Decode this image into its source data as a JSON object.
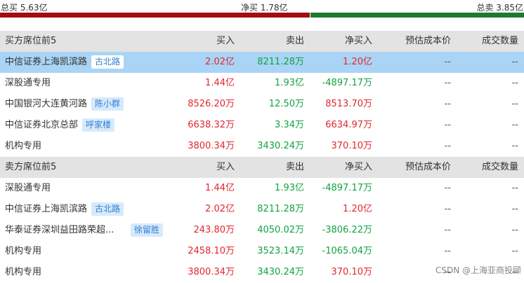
{
  "summary": {
    "total_buy": "总买 5.63亿",
    "net_buy": "净买 1.78亿",
    "total_sell": "总卖 3.85亿"
  },
  "colors": {
    "red": "#e3262e",
    "green": "#12a33f",
    "bar_red": "#a30c10",
    "bar_green": "#1d7a2e",
    "highlight": "#a9d4f5",
    "header_bg": "#e3e3e3",
    "tag_text": "#2f7fd1"
  },
  "buyers": {
    "header": {
      "name": "买方席位前5",
      "buy": "买入",
      "sell": "卖出",
      "net": "净买入",
      "cost": "预估成本价",
      "volume": "成交数量"
    },
    "rows": [
      {
        "name": "中信证券上海凯滨路",
        "tag": "古北路",
        "buy": "2.02亿",
        "sell": "8211.28万",
        "net": "1.20亿",
        "cost": "--",
        "volume": "--"
      },
      {
        "name": "深股通专用",
        "tag": "",
        "buy": "1.44亿",
        "sell": "1.93亿",
        "net": "-4897.17万",
        "cost": "--",
        "volume": "--"
      },
      {
        "name": "中国银河大连黄河路",
        "tag": "陈小群",
        "buy": "8526.20万",
        "sell": "12.50万",
        "net": "8513.70万",
        "cost": "--",
        "volume": "--"
      },
      {
        "name": "中信证券北京总部",
        "tag": "呼家楼",
        "buy": "6638.32万",
        "sell": "3.34万",
        "net": "6634.97万",
        "cost": "--",
        "volume": "--"
      },
      {
        "name": "机构专用",
        "tag": "",
        "buy": "3800.34万",
        "sell": "3430.24万",
        "net": "370.10万",
        "cost": "--",
        "volume": "--"
      }
    ]
  },
  "sellers": {
    "header": {
      "name": "卖方席位前5",
      "buy": "买入",
      "sell": "卖出",
      "net": "净买入",
      "cost": "预估成本价",
      "volume": "成交数量"
    },
    "rows": [
      {
        "name": "深股通专用",
        "tag": "",
        "buy": "1.44亿",
        "sell": "1.93亿",
        "net": "-4897.17万",
        "cost": "--",
        "volume": "--"
      },
      {
        "name": "中信证券上海凯滨路",
        "tag": "古北路",
        "buy": "2.02亿",
        "sell": "8211.28万",
        "net": "1.20亿",
        "cost": "--",
        "volume": "--"
      },
      {
        "name": "华泰证券深圳益田路荣超...",
        "tag": "徐留胜",
        "buy": "243.80万",
        "sell": "4050.02万",
        "net": "-3806.22万",
        "cost": "--",
        "volume": "--"
      },
      {
        "name": "机构专用",
        "tag": "",
        "buy": "2458.10万",
        "sell": "3523.14万",
        "net": "-1065.04万",
        "cost": "--",
        "volume": "--"
      },
      {
        "name": "机构专用",
        "tag": "",
        "buy": "3800.34万",
        "sell": "3430.24万",
        "net": "370.10万",
        "cost": "--",
        "volume": "--"
      }
    ]
  },
  "watermark": "CSDN @上海亚商投顾"
}
